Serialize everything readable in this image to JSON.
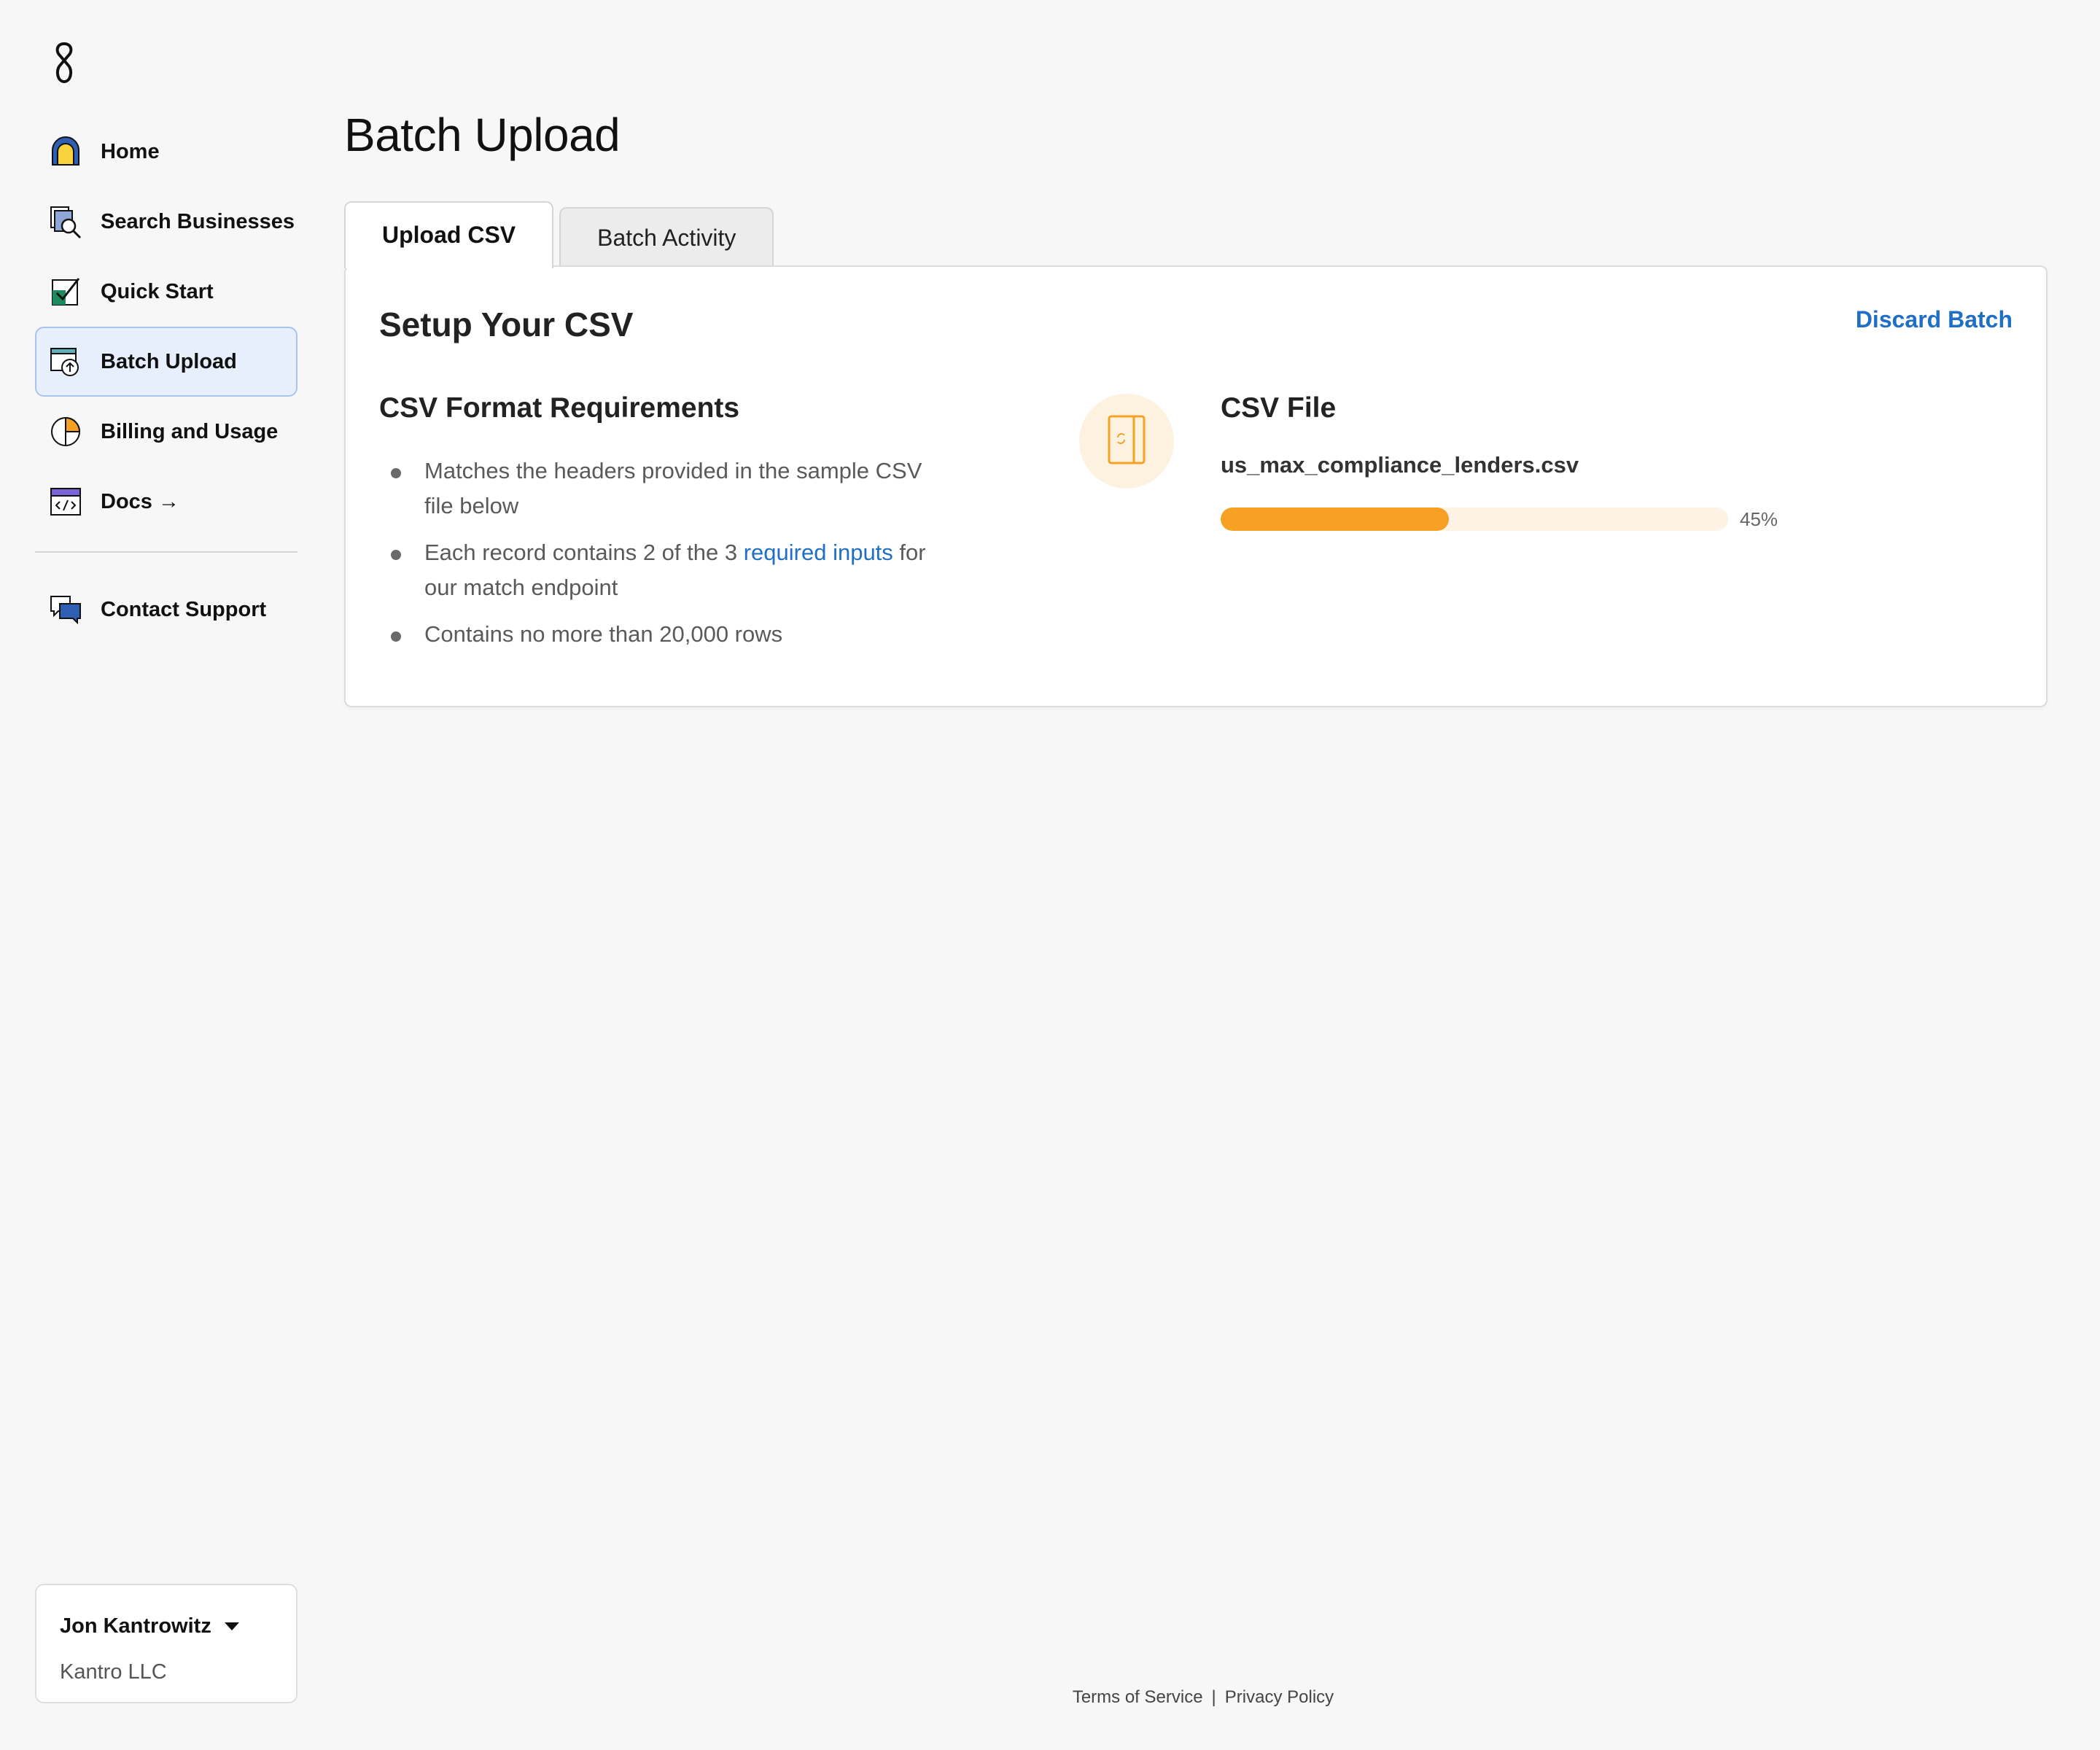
{
  "brand": {
    "logo_icon": "brand-logo-icon"
  },
  "sidebar": {
    "items": [
      {
        "label": "Home",
        "icon": "home-arch-icon",
        "active": false
      },
      {
        "label": "Search Businesses",
        "icon": "search-documents-icon",
        "active": false
      },
      {
        "label": "Quick Start",
        "icon": "checkmark-box-icon",
        "active": false
      },
      {
        "label": "Batch Upload",
        "icon": "upload-icon",
        "active": true
      },
      {
        "label": "Billing and Usage",
        "icon": "pie-chart-icon",
        "active": false
      },
      {
        "label": "Docs →",
        "icon": "code-window-icon",
        "active": false
      }
    ],
    "support": {
      "label": "Contact Support",
      "icon": "chat-bubbles-icon"
    }
  },
  "account": {
    "name": "Jon Kantrowitz",
    "org": "Kantro LLC"
  },
  "page": {
    "title": "Batch Upload"
  },
  "tabs": [
    {
      "label": "Upload CSV",
      "active": true
    },
    {
      "label": "Batch Activity",
      "active": false
    }
  ],
  "card": {
    "title": "Setup Your CSV",
    "discard_label": "Discard Batch",
    "requirements": {
      "title": "CSV Format Requirements",
      "items": {
        "first": "Matches the headers provided in the sample CSV file below",
        "second_pre": "Each record contains 2 of the 3 ",
        "second_link": "required inputs",
        "second_post": " for our match endpoint",
        "third": "Contains no more than 20,000 rows"
      }
    },
    "file": {
      "title": "CSV File",
      "name": "us_max_compliance_lenders.csv",
      "progress_percent": 45,
      "progress_label": "45%",
      "icon": "file-loading-icon"
    }
  },
  "footer": {
    "terms": "Terms of Service",
    "separator": "|",
    "privacy": "Privacy Policy"
  },
  "colors": {
    "accent": "#1f6fc6",
    "progress": "#f6a124",
    "progress_track": "#fdf2e3",
    "active_nav": "#e6effb"
  }
}
